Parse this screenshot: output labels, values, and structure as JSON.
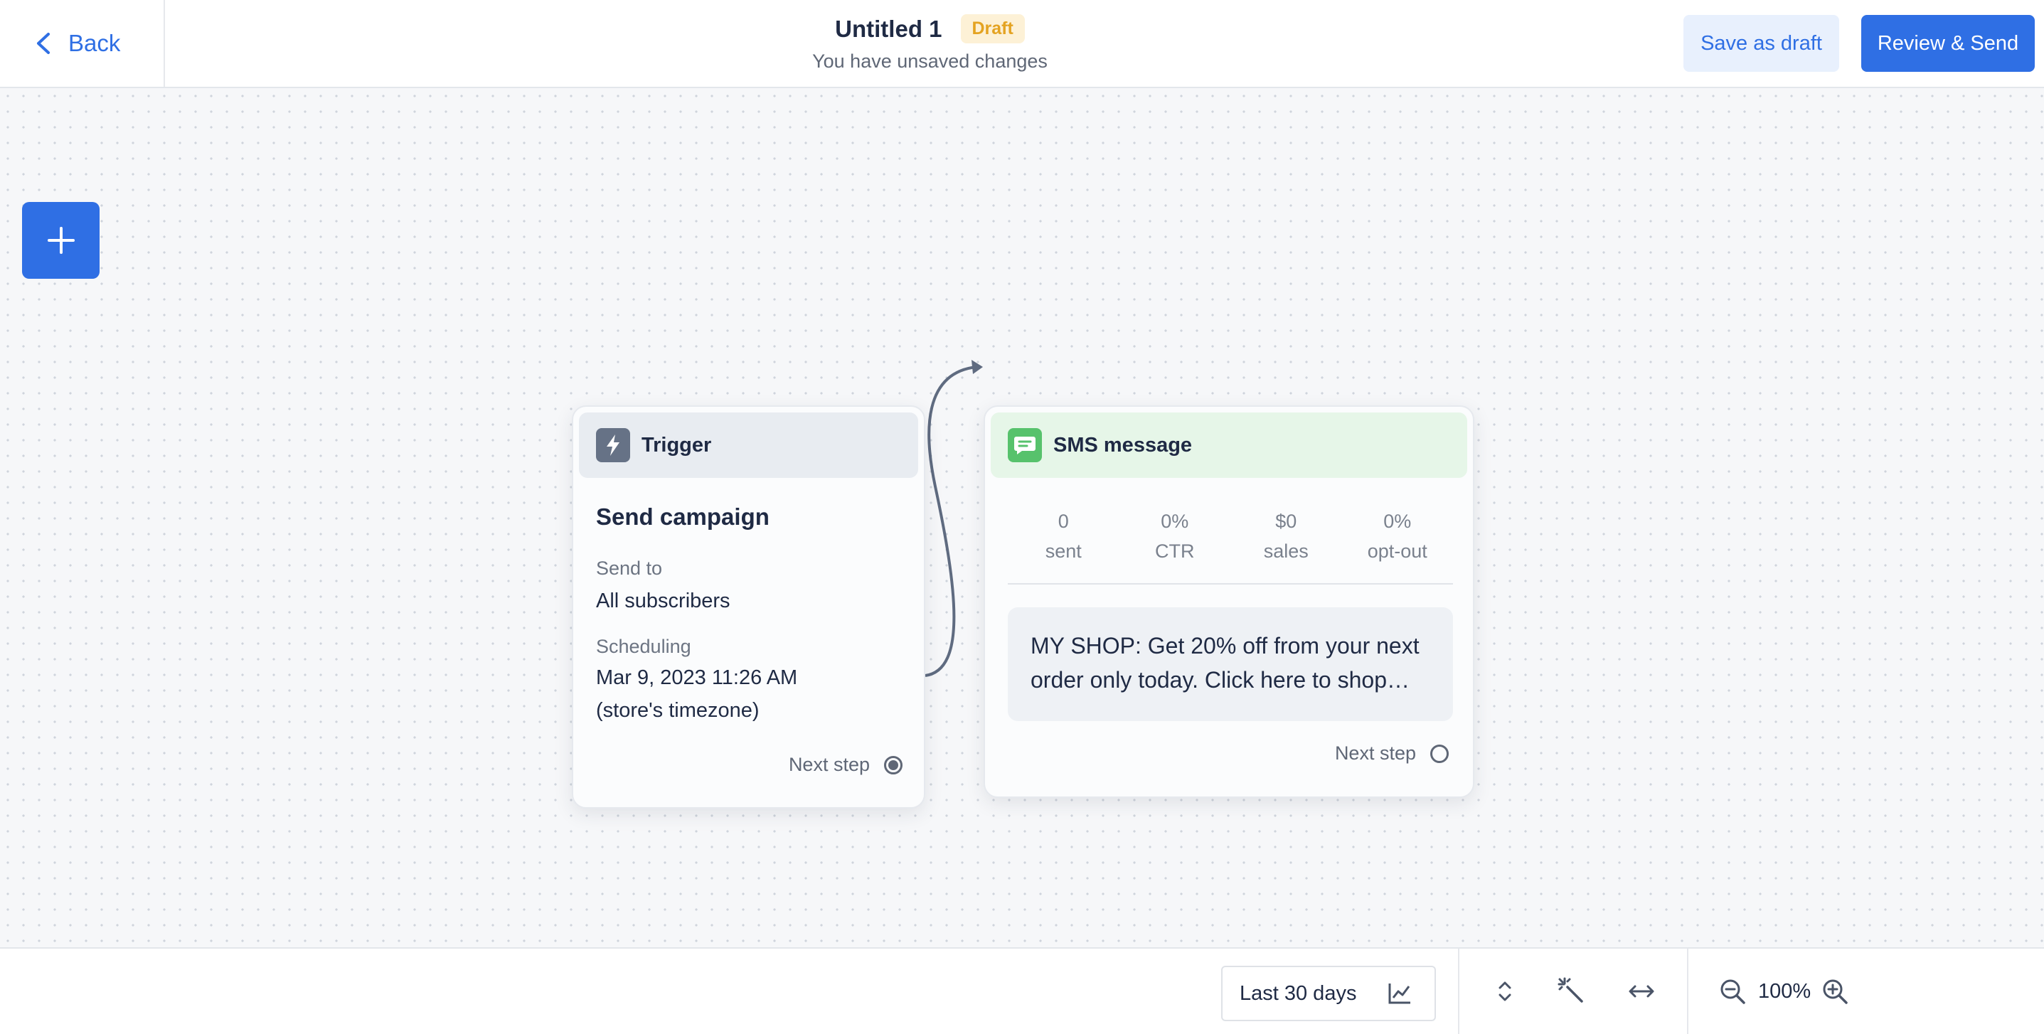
{
  "header": {
    "back_label": "Back",
    "title": "Untitled 1",
    "status_badge": "Draft",
    "subtitle": "You have unsaved changes",
    "save_draft_label": "Save as draft",
    "review_send_label": "Review & Send"
  },
  "canvas": {
    "add_icon": "plus-icon",
    "trigger_card": {
      "header_label": "Trigger",
      "icon": "lightning-icon",
      "title": "Send campaign",
      "send_to_label": "Send to",
      "send_to_value": "All subscribers",
      "scheduling_label": "Scheduling",
      "scheduling_date": "Mar 9, 2023 11:26 AM",
      "scheduling_timezone": "(store's timezone)",
      "next_step_label": "Next step"
    },
    "sms_card": {
      "header_label": "SMS message",
      "icon": "chat-bubble-icon",
      "stats": [
        {
          "value": "0",
          "label": "sent"
        },
        {
          "value": "0%",
          "label": "CTR"
        },
        {
          "value": "$0",
          "label": "sales"
        },
        {
          "value": "0%",
          "label": "opt-out"
        }
      ],
      "message_preview": "MY SHOP: Get 20% off from your next order only today. Click here to shop and enjoy",
      "next_step_label": "Next step"
    }
  },
  "bottombar": {
    "date_range": "Last 30 days",
    "zoom_level": "100%"
  },
  "colors": {
    "accent": "#2f6fe4",
    "draft_badge_bg": "#fdf1d6",
    "draft_badge_text": "#e4a321",
    "sms_green": "#57c26c",
    "trigger_gray": "#667286"
  }
}
